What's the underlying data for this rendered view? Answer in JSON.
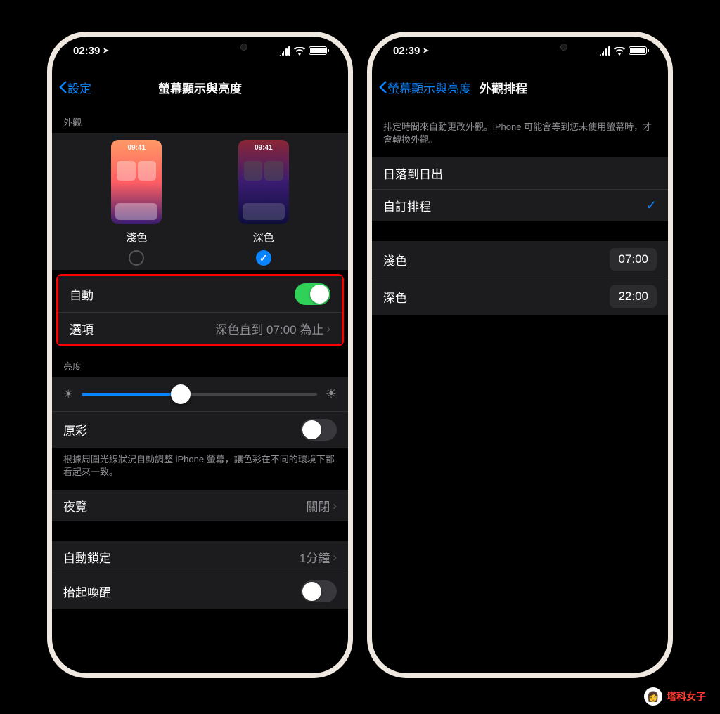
{
  "status": {
    "time": "02:39"
  },
  "left": {
    "back": "設定",
    "title": "螢幕顯示與亮度",
    "section_appearance": "外觀",
    "preview_time": "09:41",
    "light_label": "淺色",
    "dark_label": "深色",
    "auto_label": "自動",
    "options_label": "選項",
    "options_value": "深色直到 07:00 為止",
    "section_brightness": "亮度",
    "true_tone_label": "原彩",
    "true_tone_footer": "根據周圍光線狀況自動調整 iPhone 螢幕，讓色彩在不同的環境下都看起來一致。",
    "night_shift_label": "夜覽",
    "night_shift_value": "關閉",
    "auto_lock_label": "自動鎖定",
    "auto_lock_value": "1分鐘",
    "raise_wake_label": "抬起喚醒"
  },
  "right": {
    "back": "螢幕顯示與亮度",
    "title": "外觀排程",
    "footer": "排定時間來自動更改外觀。iPhone 可能會等到您未使用螢幕時，才會轉換外觀。",
    "sunset_sunrise": "日落到日出",
    "custom_schedule": "自訂排程",
    "light_label": "淺色",
    "light_time": "07:00",
    "dark_label": "深色",
    "dark_time": "22:00"
  },
  "watermark": "塔科女子"
}
